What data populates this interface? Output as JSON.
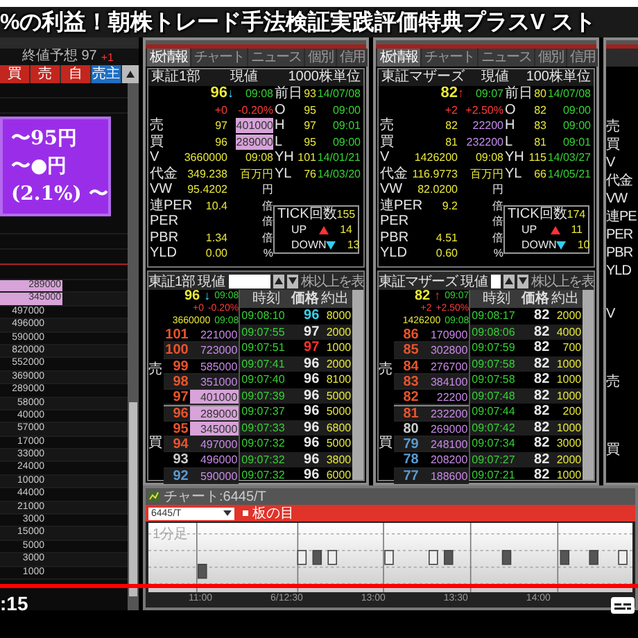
{
  "video": {
    "caption": "%の利益！朝株トレード手法検証実践評価特典プラスV スト",
    "time": ":15",
    "progress": {
      "level": 1
    }
  },
  "left_panel": {
    "header": "終値予想 97",
    "change": "+1",
    "columns": [
      {
        "label": "買",
        "kind": "buy"
      },
      {
        "label": "売",
        "kind": "buy"
      },
      {
        "label": "自",
        "kind": "buy"
      },
      {
        "label": "売主",
        "kind": "sell"
      }
    ],
    "banner_lines": [
      "〜95円",
      "〜●円",
      "(2.1%) 〜"
    ],
    "quantities": [
      {
        "value": "289000",
        "highlight": true
      },
      {
        "value": "345000",
        "highlight": true
      },
      {
        "value": "497000",
        "highlight": false
      },
      {
        "value": "496000",
        "highlight": false
      },
      {
        "value": "590000",
        "highlight": false
      },
      {
        "value": "820000",
        "highlight": false
      },
      {
        "value": "552000",
        "highlight": false
      },
      {
        "value": "369000",
        "highlight": false
      },
      {
        "value": "289000",
        "highlight": false
      },
      {
        "value": "58000",
        "highlight": false
      },
      {
        "value": "40000",
        "highlight": false
      },
      {
        "value": "57000",
        "highlight": false
      },
      {
        "value": "17000",
        "highlight": false
      },
      {
        "value": "33000",
        "highlight": false
      },
      {
        "value": "24000",
        "highlight": false
      },
      {
        "value": "10000",
        "highlight": false
      },
      {
        "value": "44000",
        "highlight": false
      },
      {
        "value": "21000",
        "highlight": false
      },
      {
        "value": "3000",
        "highlight": false
      },
      {
        "value": "15000",
        "highlight": false
      },
      {
        "value": "5000",
        "highlight": false
      },
      {
        "value": "3000",
        "highlight": false
      },
      {
        "value": "1000",
        "highlight": false
      }
    ]
  },
  "panels": [
    {
      "tabs": [
        {
          "label": "板情報",
          "selected": true
        },
        {
          "label": "チャート",
          "selected": false
        },
        {
          "label": "ニュース",
          "selected": false
        },
        {
          "label": "個別",
          "selected": false
        },
        {
          "label": "信用",
          "selected": false
        }
      ],
      "market": "東証1部",
      "price_label": "現値",
      "unit": "1000株単位",
      "price": "96",
      "arrow": "↓",
      "rising": false,
      "time": "09:08",
      "change": "+0",
      "change_pct": "-0.20%",
      "stats_left": [
        {
          "label": "売",
          "value": "97",
          "unit": "401000",
          "highlight": true
        },
        {
          "label": "買",
          "value": "96",
          "unit": "289000",
          "highlight": true
        },
        {
          "label": "V",
          "value": "3660000",
          "unit": "09:08",
          "highlight": false
        },
        {
          "label": "代金",
          "value": "349.238",
          "unit": "百万円",
          "highlight": false
        },
        {
          "label": "VW",
          "value": "95.4202",
          "unit": "円",
          "highlight": false
        },
        {
          "label": "連PER",
          "value": "10.4",
          "unit": "倍",
          "highlight": false
        },
        {
          "label": "PER",
          "unit": "倍",
          "highlight": false
        },
        {
          "label": "PBR",
          "value": "1.34",
          "unit": "倍",
          "highlight": false
        },
        {
          "label": "YLD",
          "value": "0.00",
          "unit": "%",
          "highlight": false
        }
      ],
      "stats_right": [
        {
          "label": "前日",
          "value": "93",
          "date": "14/07/08"
        },
        {
          "label": "O",
          "value": "95",
          "date": "09:00"
        },
        {
          "label": "H",
          "value": "97",
          "date": "09:01"
        },
        {
          "label": "L",
          "value": "95",
          "date": "09:00"
        },
        {
          "label": "YH",
          "value": "101",
          "date": "14/01/21"
        },
        {
          "label": "YL",
          "value": "76",
          "date": "14/03/20"
        }
      ],
      "tick_box": {
        "label": "TICK回数",
        "count": "155",
        "up_label": "UP",
        "up": "14",
        "down_label": "DOWN",
        "down": "13"
      },
      "board": {
        "market": "東証1部",
        "price_label": "現値",
        "min_label": "株以上を表",
        "price": "96",
        "arrow": "↓",
        "rising": false,
        "time": "09:08",
        "change": "+0",
        "change_pct": "-0.20%",
        "volume": "3660000",
        "volume_time": "09:08",
        "side_labels": [
          "売",
          "買"
        ],
        "columns": [
          "時刻",
          "価格",
          "約出"
        ],
        "book": [
          {
            "price": "101",
            "qty": "221000",
            "highlight": false
          },
          {
            "price": "100",
            "qty": "723000",
            "highlight": false
          },
          {
            "price": "99",
            "qty": "585000",
            "highlight": false
          },
          {
            "price": "98",
            "qty": "351000",
            "highlight": false
          },
          {
            "price": "97",
            "qty": "401000",
            "highlight": true
          },
          {
            "price": "96",
            "qty": "289000",
            "highlight": true
          },
          {
            "price": "95",
            "qty": "345000",
            "highlight": true
          },
          {
            "price": "94",
            "qty": "497000",
            "highlight": false
          },
          {
            "price": "93",
            "qty": "496000",
            "highlight": false
          },
          {
            "price": "92",
            "qty": "590000",
            "highlight": false
          }
        ],
        "ticks": [
          {
            "time": "09:08:10",
            "price": "96",
            "qty": "8000"
          },
          {
            "time": "09:07:55",
            "price": "97",
            "qty": "2000"
          },
          {
            "time": "09:07:51",
            "price": "97",
            "qty": "1000"
          },
          {
            "time": "09:07:41",
            "price": "96",
            "qty": "2000"
          },
          {
            "time": "09:07:40",
            "price": "96",
            "qty": "8100"
          },
          {
            "time": "09:07:39",
            "price": "96",
            "qty": "5000"
          },
          {
            "time": "09:07:37",
            "price": "96",
            "qty": "5000"
          },
          {
            "time": "09:07:33",
            "price": "96",
            "qty": "6800"
          },
          {
            "time": "09:07:32",
            "price": "96",
            "qty": "5000"
          },
          {
            "time": "09:07:32",
            "price": "96",
            "qty": "3800"
          },
          {
            "time": "09:07:32",
            "price": "96",
            "qty": "6000"
          }
        ]
      }
    },
    {
      "tabs": [
        {
          "label": "板情報",
          "selected": true
        },
        {
          "label": "チャート",
          "selected": false
        },
        {
          "label": "ニュース",
          "selected": false
        },
        {
          "label": "個別",
          "selected": false
        },
        {
          "label": "信用",
          "selected": false
        }
      ],
      "market": "東証マザーズ",
      "price_label": "現値",
      "unit": "100株単位",
      "price": "82",
      "arrow": "↑",
      "rising": true,
      "time": "09:07",
      "change": "+2",
      "change_pct": "+2.50%",
      "stats_left": [
        {
          "label": "売",
          "value": "82",
          "unit": "22200",
          "highlight": false
        },
        {
          "label": "買",
          "value": "81",
          "unit": "232200",
          "highlight": false
        },
        {
          "label": "V",
          "value": "1426200",
          "unit": "09:08",
          "highlight": false
        },
        {
          "label": "代金",
          "value": "116.9773",
          "unit": "百万円",
          "highlight": false
        },
        {
          "label": "VW",
          "value": "82.0200",
          "unit": "円",
          "highlight": false
        },
        {
          "label": "連PER",
          "value": "9.2",
          "unit": "倍",
          "highlight": false
        },
        {
          "label": "PER",
          "unit": "倍",
          "highlight": false
        },
        {
          "label": "PBR",
          "value": "4.51",
          "unit": "倍",
          "highlight": false
        },
        {
          "label": "YLD",
          "value": "0.60",
          "unit": "%",
          "highlight": false
        }
      ],
      "stats_right": [
        {
          "label": "前日",
          "value": "80",
          "date": "14/07/08"
        },
        {
          "label": "O",
          "value": "82",
          "date": "09:00"
        },
        {
          "label": "H",
          "value": "83",
          "date": "09:00"
        },
        {
          "label": "L",
          "value": "81",
          "date": "09:01"
        },
        {
          "label": "YH",
          "value": "115",
          "date": "14/03/27"
        },
        {
          "label": "YL",
          "value": "66",
          "date": "14/05/21"
        }
      ],
      "tick_box": {
        "label": "TICK回数",
        "count": "174",
        "up_label": "UP",
        "up": "11",
        "down_label": "DOWN",
        "down": "10"
      },
      "board": {
        "market": "東証マザーズ",
        "price_label": "現値",
        "min_label": "株以上を表",
        "price": "82",
        "arrow": "↑",
        "rising": true,
        "time": "09:07",
        "change": "+2",
        "change_pct": "+2.50%",
        "volume": "1426200",
        "volume_time": "09:08",
        "side_labels": [
          "売",
          "買"
        ],
        "columns": [
          "時刻",
          "価格",
          "約出"
        ],
        "book": [
          {
            "price": "86",
            "qty": "170900",
            "highlight": false
          },
          {
            "price": "85",
            "qty": "302800",
            "highlight": false
          },
          {
            "price": "84",
            "qty": "276700",
            "highlight": false
          },
          {
            "price": "83",
            "qty": "384100",
            "highlight": false
          },
          {
            "price": "82",
            "qty": "22200",
            "highlight": false
          },
          {
            "price": "81",
            "qty": "232200",
            "highlight": false
          },
          {
            "price": "80",
            "qty": "269000",
            "highlight": false
          },
          {
            "price": "79",
            "qty": "248100",
            "highlight": false
          },
          {
            "price": "78",
            "qty": "208200",
            "highlight": false
          },
          {
            "price": "77",
            "qty": "188600",
            "highlight": false
          }
        ],
        "ticks": [
          {
            "time": "09:08:17",
            "price": "82",
            "qty": "2000"
          },
          {
            "time": "09:08:06",
            "price": "82",
            "qty": "4000"
          },
          {
            "time": "09:07:59",
            "price": "82",
            "qty": "700"
          },
          {
            "time": "09:07:58",
            "price": "82",
            "qty": "1000"
          },
          {
            "time": "09:07:58",
            "price": "82",
            "qty": "1000"
          },
          {
            "time": "09:07:48",
            "price": "82",
            "qty": "1000"
          },
          {
            "time": "09:07:44",
            "price": "82",
            "qty": "200"
          },
          {
            "time": "09:07:42",
            "price": "82",
            "qty": "1000"
          },
          {
            "time": "09:07:34",
            "price": "82",
            "qty": "3000"
          },
          {
            "time": "09:07:27",
            "price": "82",
            "qty": "2000"
          },
          {
            "time": "09:07:21",
            "price": "82",
            "qty": "1000"
          }
        ]
      }
    }
  ],
  "partial_panel": {
    "labels": [
      "売",
      "買",
      "V",
      "代金",
      "VW",
      "連PE",
      "PER",
      "PBR",
      "YLD"
    ],
    "board_labels": [
      "V",
      "売",
      "買"
    ]
  },
  "chart": {
    "title": "チャート:6445/T",
    "symbol": "6445/T",
    "mode": "板の目",
    "interval": "1分足",
    "x_labels": [
      "11:00",
      "6/12:30",
      "13:00",
      "13:30",
      "14:00"
    ]
  }
}
